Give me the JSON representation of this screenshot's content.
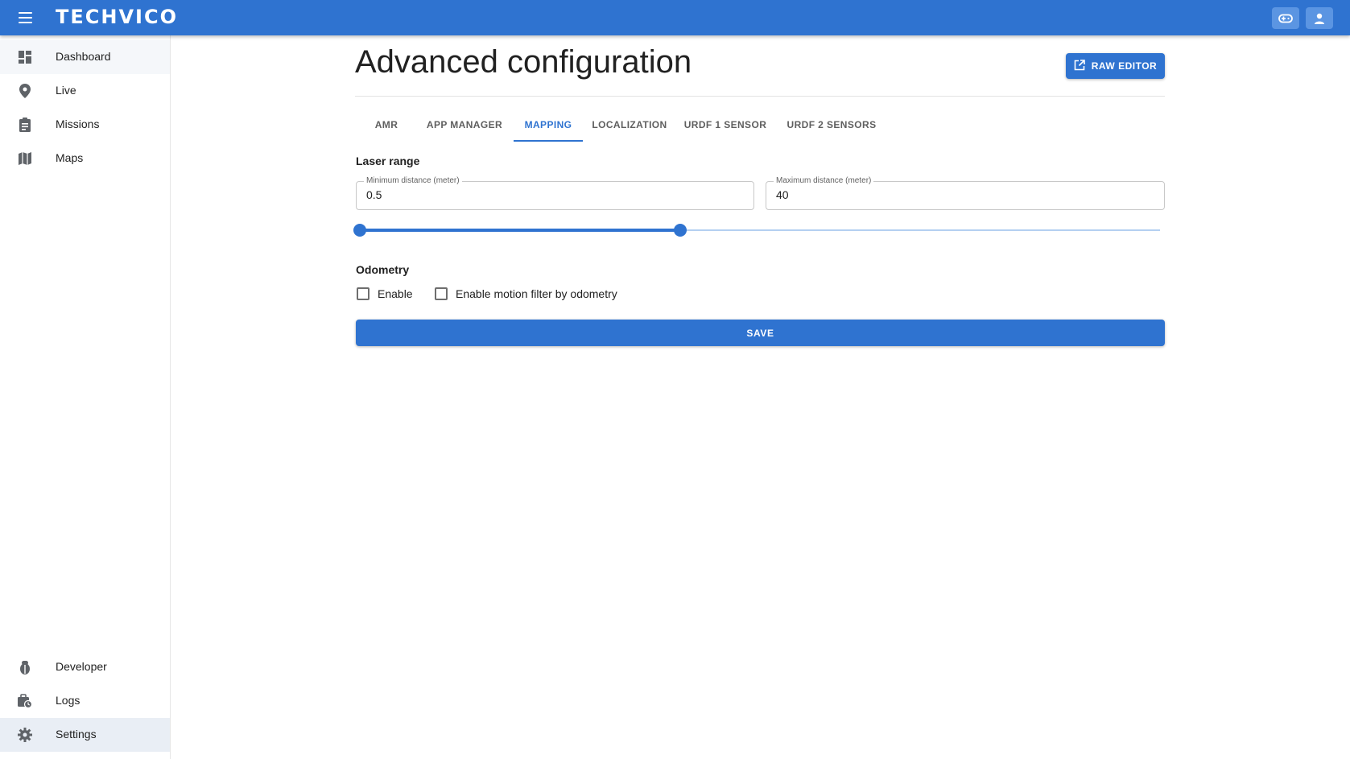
{
  "app": {
    "brand": "TECHVICO"
  },
  "sidebar": {
    "top_items": [
      {
        "label": "Dashboard",
        "icon": "dashboard-icon"
      },
      {
        "label": "Live",
        "icon": "location-pin-icon"
      },
      {
        "label": "Missions",
        "icon": "clipboard-icon"
      },
      {
        "label": "Maps",
        "icon": "map-icon"
      }
    ],
    "bottom_items": [
      {
        "label": "Developer",
        "icon": "bug-icon"
      },
      {
        "label": "Logs",
        "icon": "logs-icon"
      },
      {
        "label": "Settings",
        "icon": "gear-icon",
        "active": true
      }
    ]
  },
  "page": {
    "title": "Advanced configuration",
    "raw_editor_label": "RAW EDITOR"
  },
  "tabs": [
    {
      "label": "AMR"
    },
    {
      "label": "APP MANAGER"
    },
    {
      "label": "MAPPING",
      "active": true
    },
    {
      "label": "LOCALIZATION"
    },
    {
      "label": "URDF 1 SENSOR"
    },
    {
      "label": "URDF 2 SENSORS"
    }
  ],
  "laser_range": {
    "heading": "Laser range",
    "min_label": "Minimum distance (meter)",
    "min_value": "0.5",
    "max_label": "Maximum distance (meter)",
    "max_value": "40",
    "slider_min_fraction": 0.0,
    "slider_max_fraction": 0.4
  },
  "odometry": {
    "heading": "Odometry",
    "enable_label": "Enable",
    "enable_checked": false,
    "motion_filter_label": "Enable motion filter by odometry",
    "motion_filter_checked": false
  },
  "actions": {
    "save_label": "SAVE"
  },
  "colors": {
    "primary": "#2f73d0",
    "primary_light": "#b4d0f1"
  }
}
